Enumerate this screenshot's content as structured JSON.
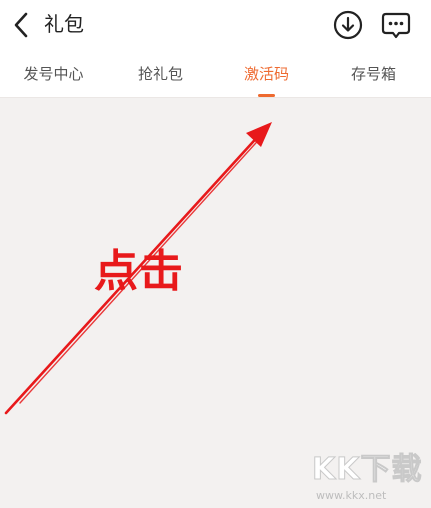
{
  "header": {
    "title": "礼包",
    "back_icon": "chevron-left-icon",
    "download_icon": "download-circle-icon",
    "message_icon": "chat-bubble-icon"
  },
  "tabs": [
    {
      "label": "发号中心",
      "active": false
    },
    {
      "label": "抢礼包",
      "active": false
    },
    {
      "label": "激活码",
      "active": true
    },
    {
      "label": "存号箱",
      "active": false
    }
  ],
  "annotation": {
    "text": "点击",
    "color": "#e8191b"
  },
  "watermark": {
    "logo": "KK下载",
    "url": "www.kkx.net"
  },
  "colors": {
    "accent": "#ee6a30",
    "background": "#f3f1f0"
  }
}
